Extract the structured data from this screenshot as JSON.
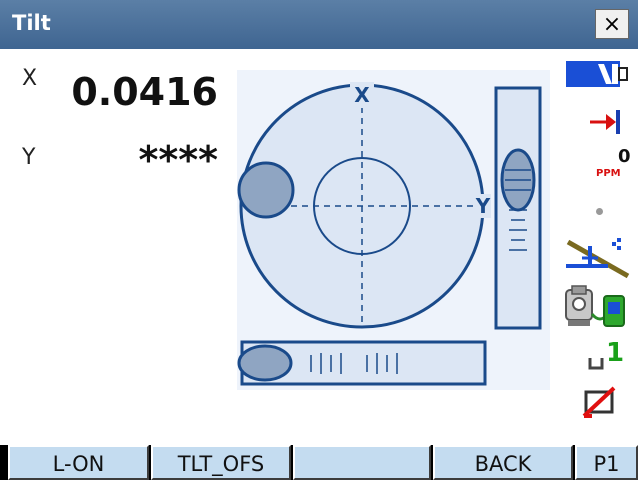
{
  "window": {
    "title": "Tilt",
    "close_glyph": "×"
  },
  "readouts": {
    "x_label": "X",
    "x_value": "0.0416",
    "y_label": "Y",
    "y_value": "****"
  },
  "graphic": {
    "circle_x_label": "X",
    "circle_y_label": "Y"
  },
  "status": {
    "ppm_value": "0",
    "ppm_label": "PPM",
    "prism_constant": "1",
    "icons": [
      "battery-icon",
      "target-arrow-icon",
      "ppm-icon",
      "dot-icon",
      "tilt-compensation-icon",
      "instrument-connection-icon",
      "prism-constant-icon",
      "no-card-icon"
    ]
  },
  "softkeys": {
    "key1": "L-ON",
    "key2": "TLT_OFS",
    "key3": "",
    "key4": "BACK",
    "key5": "P1"
  },
  "colors": {
    "title_bar": "#4a6f99",
    "accent_blue": "#1a4a8a",
    "bubble_fill": "#8fa5c2",
    "softkey_bg": "#c4dcf0",
    "red": "#e01010"
  }
}
